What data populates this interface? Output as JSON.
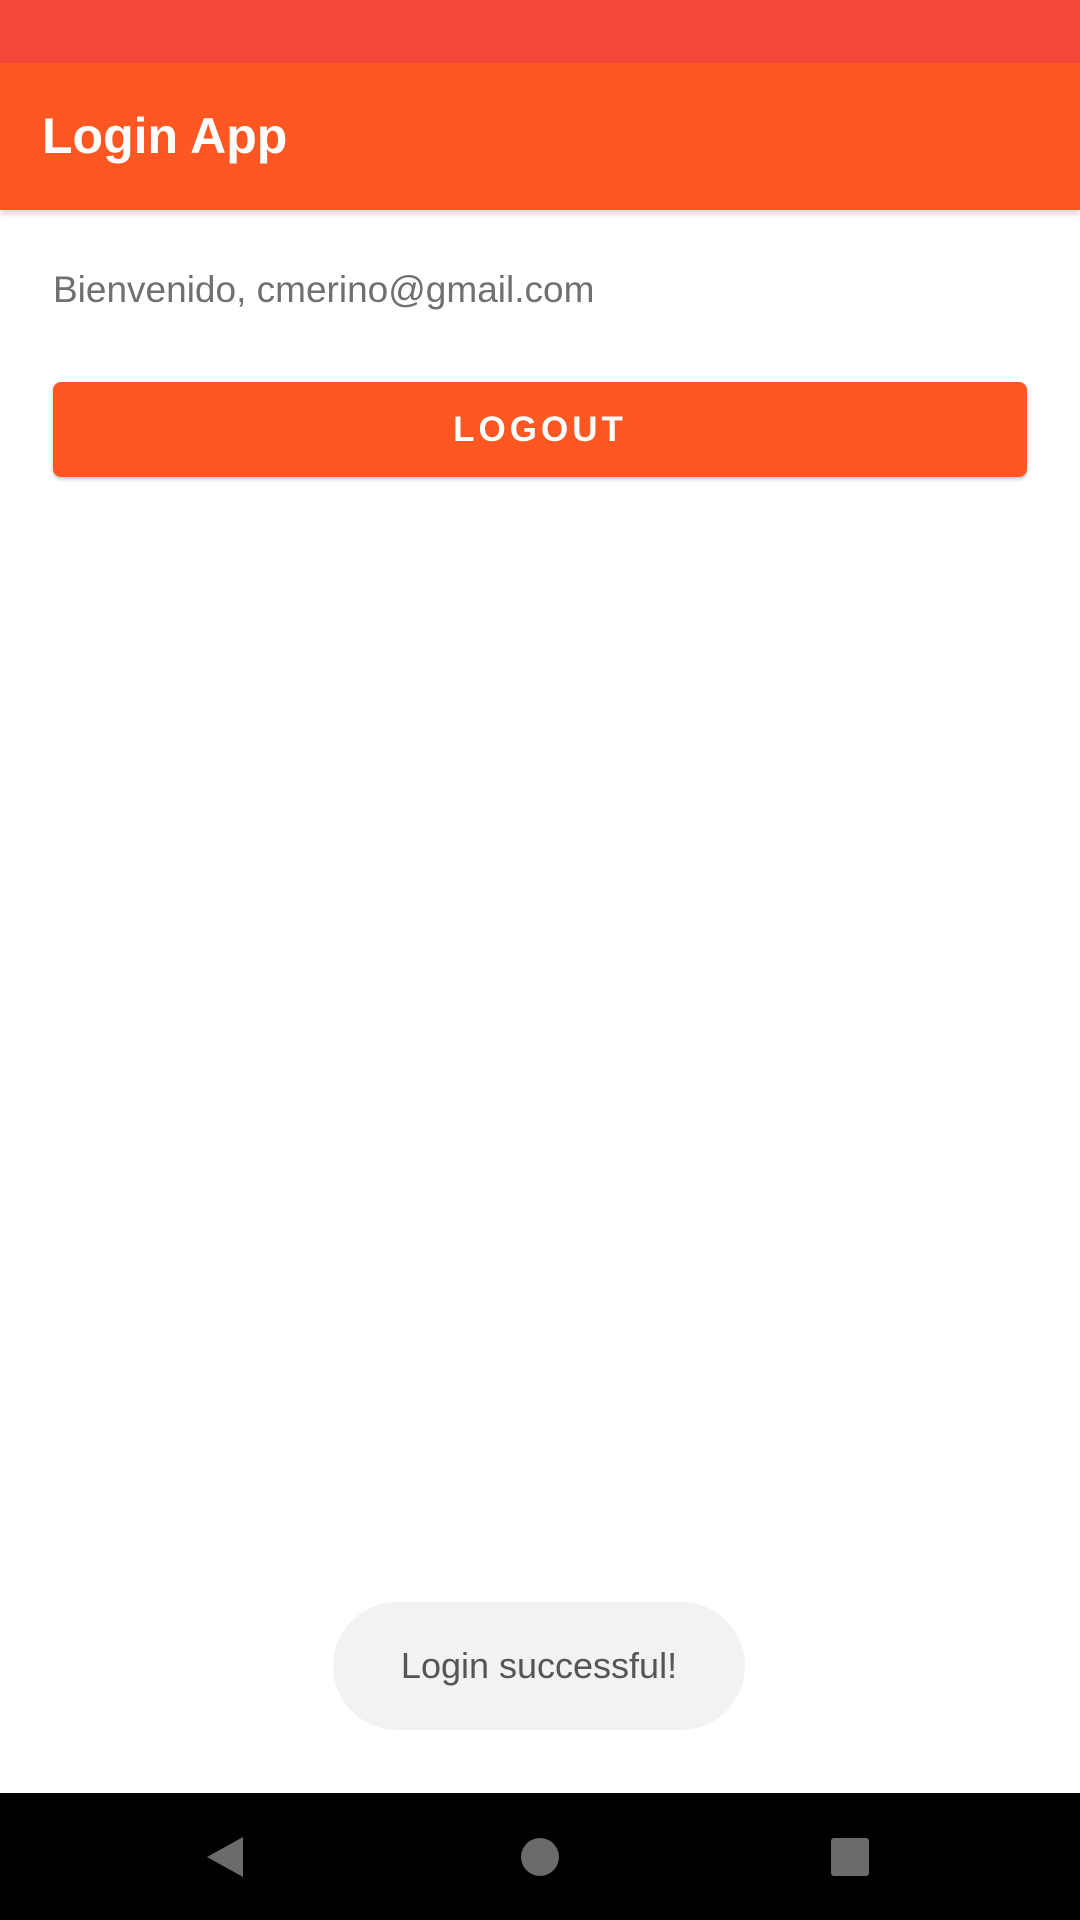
{
  "app_bar": {
    "title": "Login App",
    "color": "#ff5722"
  },
  "status_bar": {
    "color": "#f4473c"
  },
  "main": {
    "welcome_text": "Bienvenido, cmerino@gmail.com",
    "logout_label": "LOGOUT"
  },
  "toast": {
    "message": "Login successful!"
  },
  "nav_bar": {
    "icons": [
      "back-icon",
      "home-icon",
      "recents-icon"
    ]
  }
}
